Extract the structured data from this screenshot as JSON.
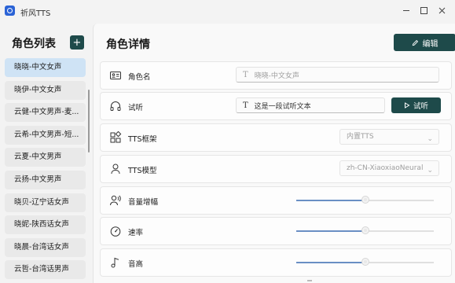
{
  "window": {
    "title": "祈风TTS"
  },
  "sidebar": {
    "title": "角色列表",
    "add_label": "+",
    "items": [
      {
        "label": "晓晓-中文女声",
        "selected": true
      },
      {
        "label": "晓伊-中文女声"
      },
      {
        "label": "云健-中文男声-麦..."
      },
      {
        "label": "云希-中文男声-短..."
      },
      {
        "label": "云夏-中文男声"
      },
      {
        "label": "云扬-中文男声"
      },
      {
        "label": "晓贝-辽宁话女声"
      },
      {
        "label": "晓妮-陕西话女声"
      },
      {
        "label": "晓晨-台湾话女声"
      },
      {
        "label": "云哲-台湾话男声"
      }
    ]
  },
  "detail": {
    "title": "角色详情",
    "edit_label": "编辑",
    "name": {
      "label": "角色名",
      "placeholder": "晓晓-中文女声"
    },
    "listen": {
      "label": "试听",
      "value": "这是一段试听文本",
      "button_label": "试听"
    },
    "framework": {
      "label": "TTS框架",
      "value": "内置TTS"
    },
    "model": {
      "label": "TTS模型",
      "value": "zh-CN-XiaoxiaoNeural"
    },
    "volume": {
      "label": "音量增幅",
      "level": 0.5
    },
    "speed": {
      "label": "速率",
      "level": 0.5
    },
    "pitch": {
      "label": "音高",
      "level": 0.5
    }
  },
  "colors": {
    "accent": "#1e4a4a",
    "selected": "#cfe3f5",
    "slider_fill": "#6a8fc4"
  }
}
